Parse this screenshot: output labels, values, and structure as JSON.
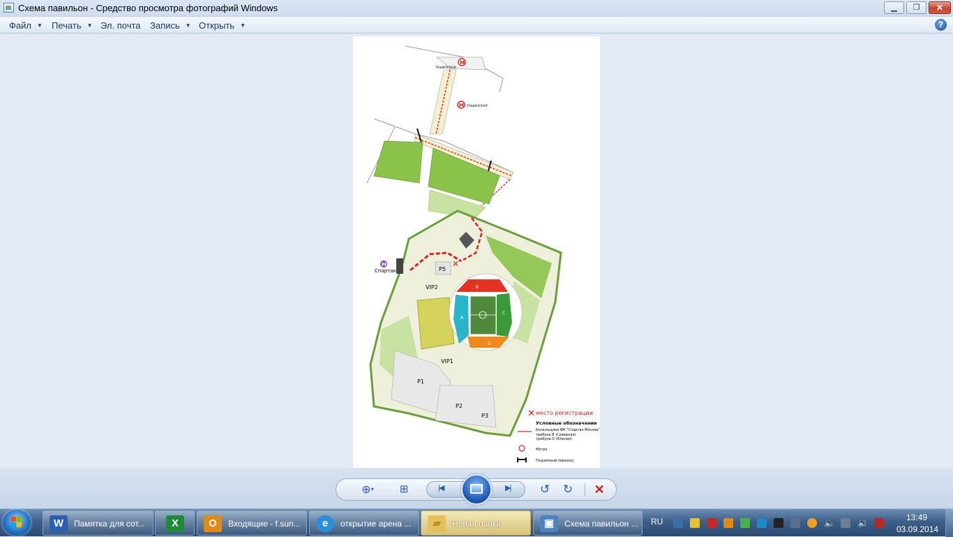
{
  "window": {
    "title": "Схема павильон - Средство просмотра фотографий Windows",
    "min_glyph": "▁",
    "max_glyph": "❐",
    "close_glyph": "✕"
  },
  "menu": {
    "items": [
      {
        "label": "Файл",
        "dropdown": true
      },
      {
        "label": "Печать",
        "dropdown": true
      },
      {
        "label": "Эл. почта",
        "dropdown": false
      },
      {
        "label": "Запись",
        "dropdown": true
      },
      {
        "label": "Открыть",
        "dropdown": true
      }
    ],
    "help_glyph": "?"
  },
  "map": {
    "metro_top": "ТУШИНСКАЯ",
    "metro_mid": "ТУШИНСКАЯ",
    "metro_left": "Спартак",
    "lots": {
      "p5": "P5",
      "vip2": "VIP2",
      "vip1": "VIP1",
      "p1": "P1",
      "p2": "P2",
      "p3": "P3"
    },
    "stands": {
      "north": "В",
      "south": "D",
      "west": "A",
      "east": "C"
    },
    "legend": {
      "registration": "место регистрации",
      "title": "Условные обозначения",
      "route_1": "Болельщики ФК \"Спартак-Москва\"",
      "route_2": "трибуна В (Северная)",
      "route_3": "трибуна D (Южная)",
      "metro": "Метро",
      "underpass": "Подземный переход"
    },
    "colors": {
      "green_dark": "#8bc34a",
      "green_light": "#c8e2a2",
      "stand_north": "#e53222",
      "stand_south": "#f08a1c",
      "stand_west": "#27b6c9",
      "stand_east": "#3a9a3a",
      "route": "#d8261e",
      "pitch": "#4f8a3a"
    }
  },
  "toolbar": {
    "zoom_glyph": "⊕",
    "zoom_caret": "▾",
    "fit_glyph": "⊞",
    "prev_glyph": "|◀",
    "next_glyph": "▶|",
    "rotate_left_glyph": "↺",
    "rotate_right_glyph": "↻",
    "delete_glyph": "✕"
  },
  "taskbar": {
    "tasks": [
      {
        "label": "Памятка для сот...",
        "icon": "W",
        "color": "#2b5fb0"
      },
      {
        "label": "",
        "icon": "X",
        "color": "#1f8a3a"
      },
      {
        "label": "Входящие - f.sun...",
        "icon": "O",
        "color": "#e08a18"
      },
      {
        "label": "открытие арена ...",
        "icon": "e",
        "color": "#2b8fd8"
      },
      {
        "label": "Новая папка",
        "icon": "▰",
        "color": "#e4c15a"
      },
      {
        "label": "Схема павильон ...",
        "icon": "▣",
        "color": "#4b83c4"
      }
    ],
    "language": "RU",
    "time": "13:49",
    "date": "03.09.2014"
  }
}
